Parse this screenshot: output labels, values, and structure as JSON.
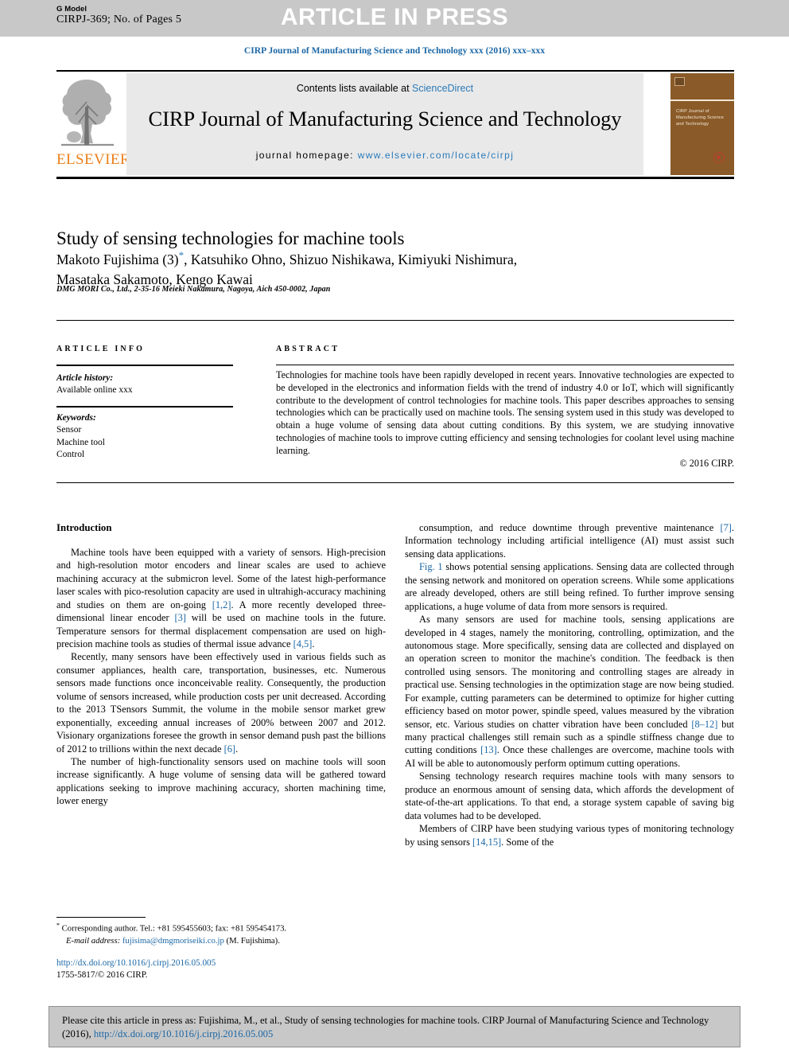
{
  "press_band": {
    "g_model_label": "G Model",
    "manuscript_id": "CIRPJ-369; No. of Pages 5",
    "banner": "ARTICLE IN PRESS"
  },
  "running_head": "CIRP Journal of Manufacturing Science and Technology xxx (2016) xxx–xxx",
  "masthead": {
    "contents_prefix": "Contents lists available at ",
    "sciencedirect": "ScienceDirect",
    "journal_name": "CIRP Journal of Manufacturing Science and Technology",
    "homepage_prefix": "journal homepage: ",
    "homepage_url": "www.elsevier.com/locate/cirpj",
    "publisher": "ELSEVIER",
    "publisher_color": "#eb7f1a",
    "link_color": "#2a7ab9",
    "cover_title": "CIRP Journal of Manufacturing Science and Technology",
    "cover_color": "#8a5a28"
  },
  "article": {
    "title": "Study of sensing technologies for machine tools",
    "authors_line1_a": "Makoto Fujishima  (3)",
    "authors_star": "*",
    "authors_line1_b": ", Katsuhiko Ohno, Shizuo Nishikawa, Kimiyuki Nishimura,",
    "authors_line2": "Masataka Sakamoto, Kengo Kawai",
    "affiliation": "DMG MORI Co., Ltd., 2-35-16 Meieki Nakamura, Nagoya, Aich 450-0002, Japan"
  },
  "article_info": {
    "heading": "ARTICLE INFO",
    "history_label": "Article history:",
    "history_value": "Available online xxx",
    "keywords_label": "Keywords:",
    "keywords": [
      "Sensor",
      "Machine tool",
      "Control"
    ]
  },
  "abstract": {
    "heading": "ABSTRACT",
    "text": "Technologies for machine tools have been rapidly developed in recent years. Innovative technologies are expected to be developed in the electronics and information fields with the trend of industry 4.0 or IoT, which will significantly contribute to the development of control technologies for machine tools. This paper describes approaches to sensing technologies which can be practically used on machine tools. The sensing system used in this study was developed to obtain a huge volume of sensing data about cutting conditions. By this system, we are studying innovative technologies of machine tools to improve cutting efficiency and sensing technologies for coolant level using machine learning.",
    "copyright": "© 2016 CIRP."
  },
  "body": {
    "section_heading": "Introduction",
    "left_paragraphs": [
      "Machine tools have been equipped with a variety of sensors. High-precision and high-resolution motor encoders and linear scales are used to achieve machining accuracy at the submicron level. Some of the latest high-performance laser scales with pico-resolution capacity are used in ultrahigh-accuracy machining and studies on them are on-going [1,2]. A more recently developed three-dimensional linear encoder [3] will be used on machine tools in the future. Temperature sensors for thermal displacement compensation are used on high-precision machine tools as studies of thermal issue advance [4,5].",
      "Recently, many sensors have been effectively used in various fields such as consumer appliances, health care, transportation, businesses, etc. Numerous sensors made functions once inconceivable reality. Consequently, the production volume of sensors increased, while production costs per unit decreased. According to the 2013 TSensors Summit, the volume in the mobile sensor market grew exponentially, exceeding annual increases of 200% between 2007 and 2012. Visionary organizations foresee the growth in sensor demand push past the billions of 2012 to trillions within the next decade [6].",
      "The number of high-functionality sensors used on machine tools will soon increase significantly. A huge volume of sensing data will be gathered toward applications seeking to improve machining accuracy, shorten machining time, lower energy"
    ],
    "right_paragraphs": [
      "consumption, and reduce downtime through preventive maintenance [7]. Information technology including artificial intelligence (AI) must assist such sensing data applications.",
      "Fig. 1 shows potential sensing applications. Sensing data are collected through the sensing network and monitored on operation screens. While some applications are already developed, others are still being refined. To further improve sensing applications, a huge volume of data from more sensors is required.",
      "As many sensors are used for machine tools, sensing applications are developed in 4 stages, namely the monitoring, controlling, optimization, and the autonomous stage. More specifically, sensing data are collected and displayed on an operation screen to monitor the machine's condition. The feedback is then controlled using sensors. The monitoring and controlling stages are already in practical use. Sensing technologies in the optimization stage are now being studied. For example, cutting parameters can be determined to optimize for higher cutting efficiency based on motor power, spindle speed, values measured by the vibration sensor, etc. Various studies on chatter vibration have been concluded [8–12] but many practical challenges still remain such as a spindle stiffness change due to cutting conditions [13]. Once these challenges are overcome, machine tools with AI will be able to autonomously perform optimum cutting operations.",
      "Sensing technology research requires machine tools with many sensors to produce an enormous amount of sensing data, which affords the development of state-of-the-art applications. To that end, a storage system capable of saving big data volumes had to be developed.",
      "Members of CIRP have been studying various types of monitoring technology by using sensors [14,15]. Some of the"
    ]
  },
  "footnote": {
    "marker": "*",
    "corresponding": " Corresponding author. Tel.: +81 595455603; fax: +81 595454173.",
    "email_label": "E-mail address:",
    "email": "fujisima@dmgmoriseiki.co.jp",
    "email_suffix": " (M. Fujishima).",
    "doi": "http://dx.doi.org/10.1016/j.cirpj.2016.05.005",
    "issn_line": "1755-5817/© 2016 CIRP."
  },
  "cite_box": {
    "text_before": "Please cite this article in press as: Fujishima, M., et al., Study of sensing technologies for machine tools. CIRP Journal of Manufacturing Science and Technology (2016), ",
    "doi": "http://dx.doi.org/10.1016/j.cirpj.2016.05.005"
  }
}
